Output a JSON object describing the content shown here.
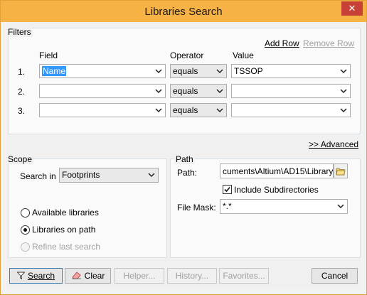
{
  "window": {
    "title": "Libraries Search",
    "close_glyph": "✕"
  },
  "filters": {
    "group_title": "Filters",
    "add_row": "Add Row",
    "remove_row": "Remove Row",
    "col_field": "Field",
    "col_operator": "Operator",
    "col_value": "Value",
    "rows": [
      {
        "num": "1.",
        "field": "Name",
        "operator": "equals",
        "value": "TSSOP"
      },
      {
        "num": "2.",
        "field": "",
        "operator": "equals",
        "value": ""
      },
      {
        "num": "3.",
        "field": "",
        "operator": "equals",
        "value": ""
      }
    ],
    "advanced": ">> Advanced"
  },
  "scope": {
    "group_title": "Scope",
    "search_in_label": "Search in",
    "search_in_value": "Footprints",
    "options": [
      {
        "label": "Available libraries",
        "checked": false,
        "enabled": true
      },
      {
        "label": "Libraries on path",
        "checked": true,
        "enabled": true
      },
      {
        "label": "Refine last search",
        "checked": false,
        "enabled": false
      }
    ]
  },
  "path": {
    "group_title": "Path",
    "path_label": "Path:",
    "path_value": "cuments\\Altium\\AD15\\Library\\",
    "include_subdirs_label": "Include Subdirectories",
    "include_subdirs_checked": true,
    "file_mask_label": "File Mask:",
    "file_mask_value": "*.*"
  },
  "buttons": {
    "search": "Search",
    "clear": "Clear",
    "helper": "Helper...",
    "history": "History...",
    "favorites": "Favorites...",
    "cancel": "Cancel"
  },
  "icons": {
    "search_button_icon": "funnel-icon",
    "clear_button_icon": "eraser-icon",
    "browse_icon": "folder-icon"
  }
}
